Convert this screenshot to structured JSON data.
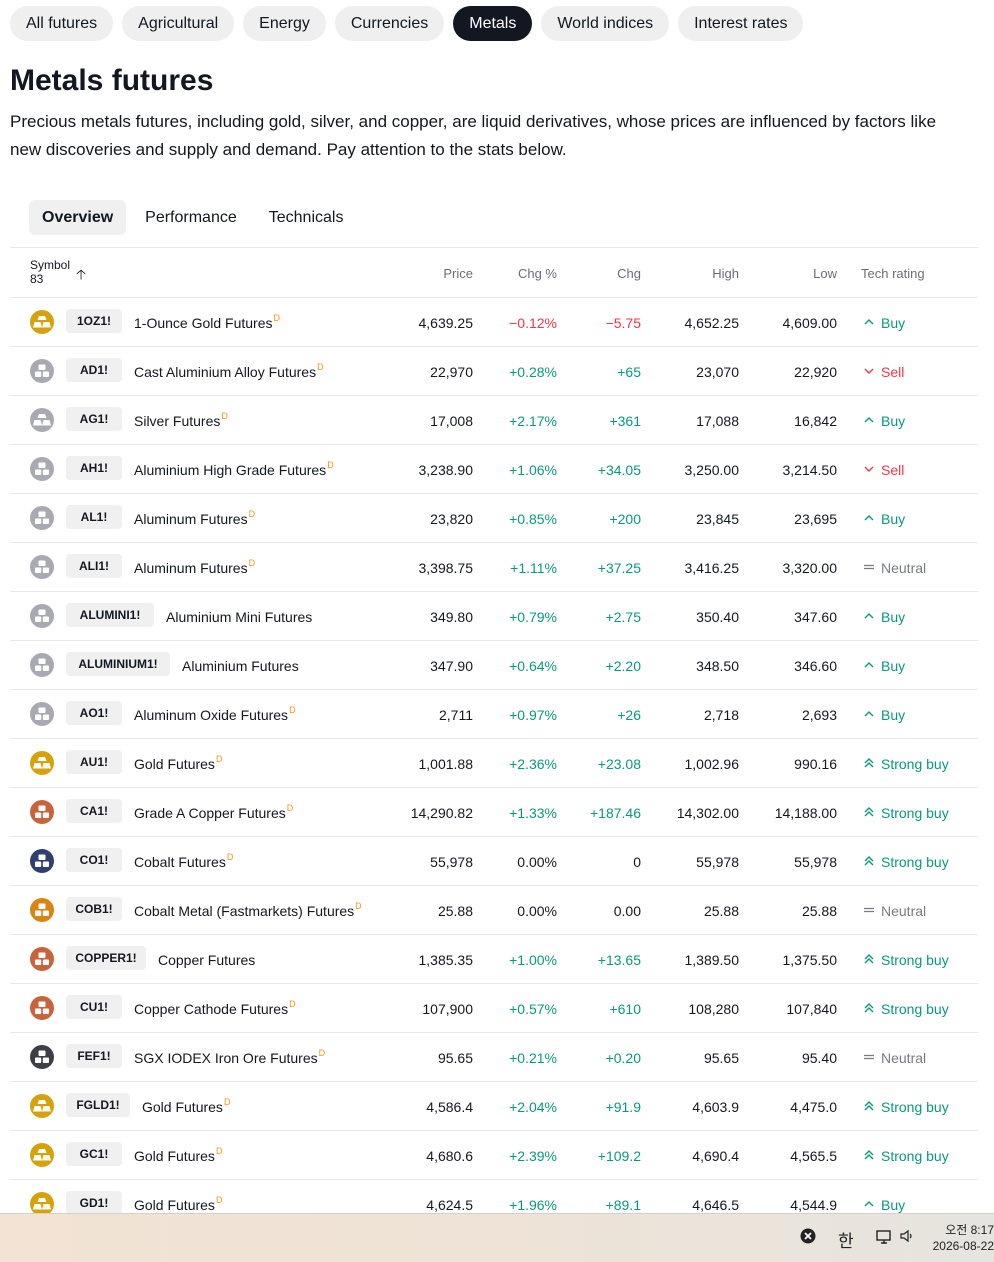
{
  "categories": [
    "All futures",
    "Agricultural",
    "Energy",
    "Currencies",
    "Metals",
    "World indices",
    "Interest rates"
  ],
  "active_category": "Metals",
  "page_title": "Metals futures",
  "description": "Precious metals futures, including gold, silver, and copper, are liquid derivatives, whose prices are influenced by factors like new discoveries and supply and demand. Pay attention to the stats below.",
  "subtabs": [
    "Overview",
    "Performance",
    "Technicals"
  ],
  "active_subtab": "Overview",
  "table": {
    "headers": {
      "symbol": "Symbol",
      "count": "83",
      "price": "Price",
      "chg_pct": "Chg %",
      "chg": "Chg",
      "high": "High",
      "low": "Low",
      "rating": "Tech rating"
    },
    "rows": [
      {
        "ticker": "1OZ1!",
        "name": "1-Ounce Gold Futures",
        "delayed": true,
        "logo": "gold",
        "price": "4,639.25",
        "chg_pct": "−0.12%",
        "chg": "−5.75",
        "dir": "neg",
        "high": "4,652.25",
        "low": "4,609.00",
        "rating": "Buy",
        "rating_kind": "buy"
      },
      {
        "ticker": "AD1!",
        "name": "Cast Aluminium Alloy Futures",
        "delayed": true,
        "logo": "grey",
        "price": "22,970",
        "chg_pct": "+0.28%",
        "chg": "+65",
        "dir": "pos",
        "high": "23,070",
        "low": "22,920",
        "rating": "Sell",
        "rating_kind": "sell"
      },
      {
        "ticker": "AG1!",
        "name": "Silver Futures",
        "delayed": true,
        "logo": "silver",
        "price": "17,008",
        "chg_pct": "+2.17%",
        "chg": "+361",
        "dir": "pos",
        "high": "17,088",
        "low": "16,842",
        "rating": "Buy",
        "rating_kind": "buy"
      },
      {
        "ticker": "AH1!",
        "name": "Aluminium High Grade Futures",
        "delayed": true,
        "logo": "grey",
        "price": "3,238.90",
        "chg_pct": "+1.06%",
        "chg": "+34.05",
        "dir": "pos",
        "high": "3,250.00",
        "low": "3,214.50",
        "rating": "Sell",
        "rating_kind": "sell"
      },
      {
        "ticker": "AL1!",
        "name": "Aluminum Futures",
        "delayed": true,
        "logo": "grey",
        "price": "23,820",
        "chg_pct": "+0.85%",
        "chg": "+200",
        "dir": "pos",
        "high": "23,845",
        "low": "23,695",
        "rating": "Buy",
        "rating_kind": "buy"
      },
      {
        "ticker": "ALI1!",
        "name": "Aluminum Futures",
        "delayed": true,
        "logo": "grey",
        "price": "3,398.75",
        "chg_pct": "+1.11%",
        "chg": "+37.25",
        "dir": "pos",
        "high": "3,416.25",
        "low": "3,320.00",
        "rating": "Neutral",
        "rating_kind": "neutral"
      },
      {
        "ticker": "ALUMINI1!",
        "name": "Aluminium Mini Futures",
        "delayed": false,
        "logo": "grey",
        "price": "349.80",
        "chg_pct": "+0.79%",
        "chg": "+2.75",
        "dir": "pos",
        "high": "350.40",
        "low": "347.60",
        "rating": "Buy",
        "rating_kind": "buy"
      },
      {
        "ticker": "ALUMINIUM1!",
        "name": "Aluminium Futures",
        "delayed": false,
        "logo": "grey",
        "price": "347.90",
        "chg_pct": "+0.64%",
        "chg": "+2.20",
        "dir": "pos",
        "high": "348.50",
        "low": "346.60",
        "rating": "Buy",
        "rating_kind": "buy"
      },
      {
        "ticker": "AO1!",
        "name": "Aluminum Oxide Futures",
        "delayed": true,
        "logo": "grey",
        "price": "2,711",
        "chg_pct": "+0.97%",
        "chg": "+26",
        "dir": "pos",
        "high": "2,718",
        "low": "2,693",
        "rating": "Buy",
        "rating_kind": "buy"
      },
      {
        "ticker": "AU1!",
        "name": "Gold Futures",
        "delayed": true,
        "logo": "gold",
        "price": "1,001.88",
        "chg_pct": "+2.36%",
        "chg": "+23.08",
        "dir": "pos",
        "high": "1,002.96",
        "low": "990.16",
        "rating": "Strong buy",
        "rating_kind": "strong"
      },
      {
        "ticker": "CA1!",
        "name": "Grade A Copper Futures",
        "delayed": true,
        "logo": "copper",
        "price": "14,290.82",
        "chg_pct": "+1.33%",
        "chg": "+187.46",
        "dir": "pos",
        "high": "14,302.00",
        "low": "14,188.00",
        "rating": "Strong buy",
        "rating_kind": "strong"
      },
      {
        "ticker": "CO1!",
        "name": "Cobalt Futures",
        "delayed": true,
        "logo": "cobalt",
        "price": "55,978",
        "chg_pct": "0.00%",
        "chg": "0",
        "dir": "neu",
        "high": "55,978",
        "low": "55,978",
        "rating": "Strong buy",
        "rating_kind": "strong"
      },
      {
        "ticker": "COB1!",
        "name": "Cobalt Metal (Fastmarkets) Futures",
        "delayed": true,
        "logo": "orange",
        "price": "25.88",
        "chg_pct": "0.00%",
        "chg": "0.00",
        "dir": "neu",
        "high": "25.88",
        "low": "25.88",
        "rating": "Neutral",
        "rating_kind": "neutral"
      },
      {
        "ticker": "COPPER1!",
        "name": "Copper Futures",
        "delayed": false,
        "logo": "copper",
        "price": "1,385.35",
        "chg_pct": "+1.00%",
        "chg": "+13.65",
        "dir": "pos",
        "high": "1,389.50",
        "low": "1,375.50",
        "rating": "Strong buy",
        "rating_kind": "strong"
      },
      {
        "ticker": "CU1!",
        "name": "Copper Cathode Futures",
        "delayed": true,
        "logo": "copper",
        "price": "107,900",
        "chg_pct": "+0.57%",
        "chg": "+610",
        "dir": "pos",
        "high": "108,280",
        "low": "107,840",
        "rating": "Strong buy",
        "rating_kind": "strong"
      },
      {
        "ticker": "FEF1!",
        "name": "SGX IODEX Iron Ore Futures",
        "delayed": true,
        "logo": "dark",
        "price": "95.65",
        "chg_pct": "+0.21%",
        "chg": "+0.20",
        "dir": "pos",
        "high": "95.65",
        "low": "95.40",
        "rating": "Neutral",
        "rating_kind": "neutral"
      },
      {
        "ticker": "FGLD1!",
        "name": "Gold Futures",
        "delayed": true,
        "logo": "gold",
        "price": "4,586.4",
        "chg_pct": "+2.04%",
        "chg": "+91.9",
        "dir": "pos",
        "high": "4,603.9",
        "low": "4,475.0",
        "rating": "Strong buy",
        "rating_kind": "strong"
      },
      {
        "ticker": "GC1!",
        "name": "Gold Futures",
        "delayed": true,
        "logo": "gold",
        "price": "4,680.6",
        "chg_pct": "+2.39%",
        "chg": "+109.2",
        "dir": "pos",
        "high": "4,690.4",
        "low": "4,565.5",
        "rating": "Strong buy",
        "rating_kind": "strong"
      },
      {
        "ticker": "GD1!",
        "name": "Gold Futures",
        "delayed": true,
        "logo": "gold",
        "price": "4,624.5",
        "chg_pct": "+1.96%",
        "chg": "+89.1",
        "dir": "pos",
        "high": "4,646.5",
        "low": "4,544.9",
        "rating": "Buy",
        "rating_kind": "buy"
      }
    ],
    "delayed_mark": "D"
  },
  "logo_colors": {
    "gold": "#d7a10b",
    "silver": "#a9a9b3",
    "grey": "#a9a9b3",
    "copper": "#c8643c",
    "cobalt": "#2f3f6e",
    "orange": "#d98512",
    "dark": "#3d3f47"
  },
  "taskbar": {
    "ime": "한",
    "time": "오전 8:17",
    "date": "2026-08-22"
  }
}
